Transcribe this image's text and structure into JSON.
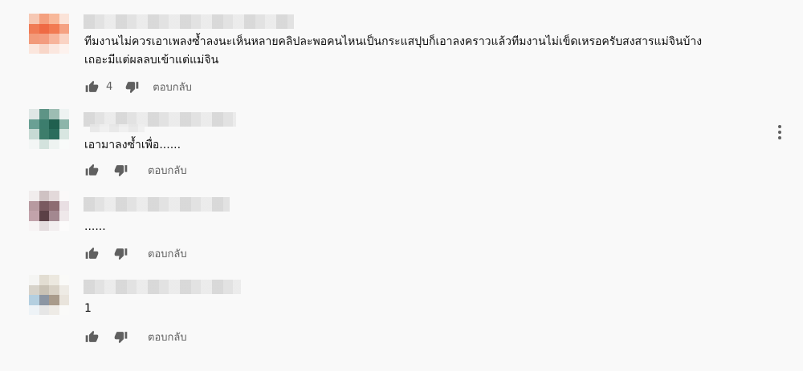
{
  "comments": [
    {
      "text_lines": [
        "ทีมงานไม่ควรเอาเพลงซ้ำลงนะเห็นหลายคลิปละพอคนไหนเป็นกระแสปุบก็เอาลงคราวแล้วทีมงานไม่เข็ดเหรอครับสงสารแม่จินบ้าง",
        "เถอะมีแต่ผลลบเข้าแต่แม่จิน"
      ],
      "like_count": "4",
      "reply_label": "ตอบกลับ"
    },
    {
      "text_lines": [
        "เอามาลงซ้ำเพื่อ......"
      ],
      "like_count": "",
      "reply_label": "ตอบกลับ"
    },
    {
      "text_lines": [
        "......"
      ],
      "like_count": "",
      "reply_label": "ตอบกลับ"
    },
    {
      "text_lines": [
        "1"
      ],
      "like_count": "",
      "reply_label": "ตอบกลับ"
    }
  ],
  "icons": {
    "like": "thumb-up-icon",
    "dislike": "thumb-down-icon",
    "menu": "more-vertical-icon"
  }
}
